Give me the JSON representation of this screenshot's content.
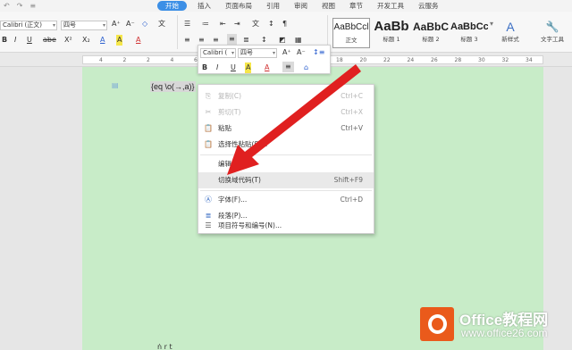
{
  "quick_access": {
    "undo": "↶",
    "redo": "↷",
    "more": "≡"
  },
  "tabs": [
    {
      "label": "开始",
      "active": true
    },
    {
      "label": "插入"
    },
    {
      "label": "页面布局"
    },
    {
      "label": "引用"
    },
    {
      "label": "审阅"
    },
    {
      "label": "视图"
    },
    {
      "label": "章节"
    },
    {
      "label": "开发工具"
    },
    {
      "label": "云服务"
    }
  ],
  "ribbon": {
    "font_name": "Calibri (正文)",
    "font_size": "四号",
    "bold": "B",
    "italic": "I",
    "underline": "U",
    "strike": "abe",
    "superscript": "X²",
    "subscript": "X₂",
    "grow_font": "A⁺",
    "shrink_font": "A⁻",
    "clear_format": "◇",
    "pinyin": "文",
    "font_color": "A",
    "highlight": "A",
    "styles": [
      {
        "sample": "AaBbCcl",
        "name": "正文",
        "selected": true
      },
      {
        "sample": "AaBb",
        "name": "标题 1"
      },
      {
        "sample": "AaBbC",
        "name": "标题 2"
      },
      {
        "sample": "AaBbCc",
        "name": "标题 3"
      }
    ],
    "new_style": "新样式",
    "text_tools": "文字工具"
  },
  "ruler_numbers": [
    "4",
    "2",
    "2",
    "4",
    "6",
    "8",
    "10",
    "12",
    "14",
    "16",
    "18",
    "20",
    "22",
    "24",
    "26",
    "28",
    "30",
    "32",
    "34"
  ],
  "document": {
    "field_code": "{eq \\o(→,a)}",
    "bottom_text": "ṅ  r  t"
  },
  "mini_toolbar": {
    "font_name": "Calibri (",
    "font_size": "四号",
    "grow": "A⁺",
    "shrink": "A⁻",
    "line_spacing": "↕≡",
    "bold": "B",
    "italic": "I",
    "underline": "U",
    "highlight": "A",
    "font_color": "A",
    "align": "≡",
    "format_painter": "⌂"
  },
  "context_menu": [
    {
      "label": "复制(C)",
      "shortcut": "Ctrl+C",
      "icon": "copy-icon",
      "glyph": "⎘",
      "disabled": true
    },
    {
      "label": "剪切(T)",
      "shortcut": "Ctrl+X",
      "icon": "cut-icon",
      "glyph": "✂",
      "disabled": true
    },
    {
      "label": "粘贴",
      "shortcut": "Ctrl+V",
      "icon": "paste-icon",
      "glyph": "📋"
    },
    {
      "label": "选择性粘贴(S)...",
      "shortcut": "",
      "icon": "paste-special-icon",
      "glyph": "📋"
    },
    {
      "label": "编辑域(E)...",
      "shortcut": "",
      "icon": "",
      "glyph": ""
    },
    {
      "label": "切换域代码(T)",
      "shortcut": "Shift+F9",
      "icon": "",
      "glyph": "",
      "highlighted": true
    },
    {
      "label": "字体(F)...",
      "shortcut": "Ctrl+D",
      "icon": "font-icon",
      "glyph": "Ⓐ"
    },
    {
      "label": "段落(P)...",
      "shortcut": "",
      "icon": "paragraph-icon",
      "glyph": "≣"
    },
    {
      "label": "项目符号和编号(N)...",
      "shortcut": "",
      "icon": "bullets-icon",
      "glyph": "☰"
    }
  ],
  "watermark": {
    "title": "Office教程网",
    "url": "www.office26.com"
  },
  "colors": {
    "accent": "#3c8fe6",
    "page": "#c8ecc8",
    "arrow": "#e02020",
    "logo": "#ea5a1b"
  }
}
